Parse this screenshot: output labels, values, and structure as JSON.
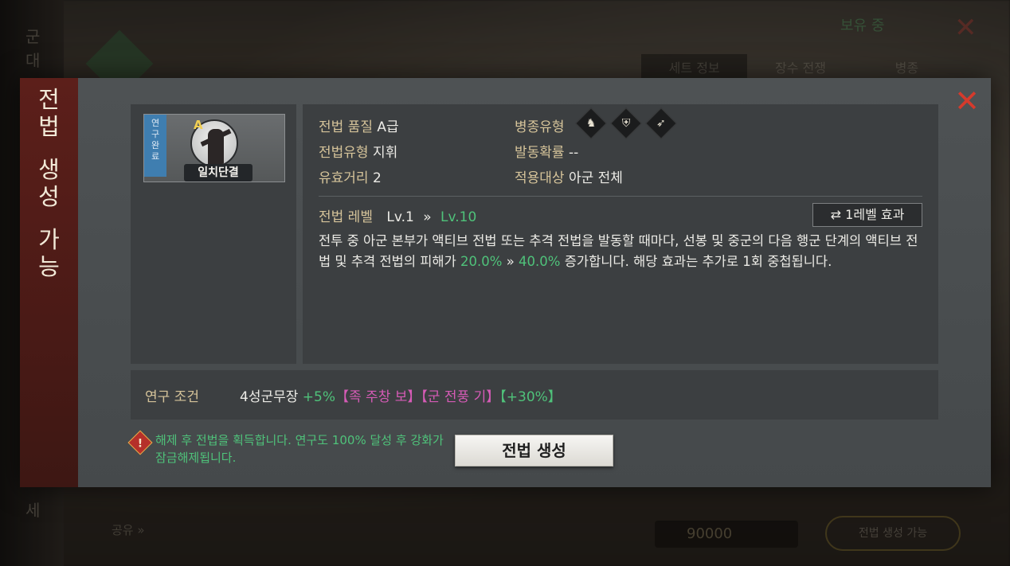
{
  "sidebar": {
    "title_chars": [
      "전",
      "법",
      "생",
      "성",
      "가",
      "능"
    ]
  },
  "card": {
    "ribbon_chars": [
      "연",
      "구",
      "완",
      "료"
    ],
    "grade": "A",
    "name": "일치단결"
  },
  "attributes": {
    "quality_label": "전법 품질",
    "quality_value": "A급",
    "type_label": "전법유형",
    "type_value": "지휘",
    "range_label": "유효거리",
    "range_value": "2",
    "troop_label": "병종유형",
    "troop_icons": [
      "cavalry-icon",
      "shield-icon",
      "bow-icon"
    ],
    "rate_label": "발동확률",
    "rate_value": "--",
    "target_label": "적용대상",
    "target_value": "아군 전체"
  },
  "level": {
    "label": "전법 레벨",
    "current": "Lv.1",
    "arrow": "»",
    "max": "Lv.10",
    "toggle_label": "1레벨 효과"
  },
  "description": {
    "part1": "전투 중 아군 본부가 액티브 전법 또는 추격 전법을 발동할 때마다, 선봉 및 중군의 다음 행군 단계의 액티브 전법 및 추격 전법의 피해가 ",
    "value_from": "20.0%",
    "arrow": " » ",
    "value_to": "40.0%",
    "part2": " 증가합니다. 해당 효과는 추가로 1회 중첩됩니다."
  },
  "condition": {
    "label": "연구 조건",
    "general": "4성군무장",
    "bonus1": "+5%",
    "tag1": "【족 주창 보】",
    "tag2": "【군 전풍 기】",
    "bonus2": "【+30%】"
  },
  "notice": {
    "text": "해제 후 전법을 획득합니다. 연구도 100% 달성 후 강화가 잠금해제됩니다."
  },
  "buttons": {
    "create": "전법 생성"
  },
  "background": {
    "left_chars": [
      "군",
      "대",
      "세"
    ],
    "tabs": [
      "세트 정보",
      "장수 전쟁",
      "병종"
    ],
    "top_right": "보유 중",
    "bottom_left": "공유 »",
    "currency": "90000",
    "bottom_button": "전법 생성 가능"
  },
  "colors": {
    "accent_green": "#4fc27a",
    "label_gold": "#d6c49a",
    "tag_pink": "#d65bb6",
    "close_red": "#d53a2c",
    "sidebar_red": "#5c1f1a"
  }
}
